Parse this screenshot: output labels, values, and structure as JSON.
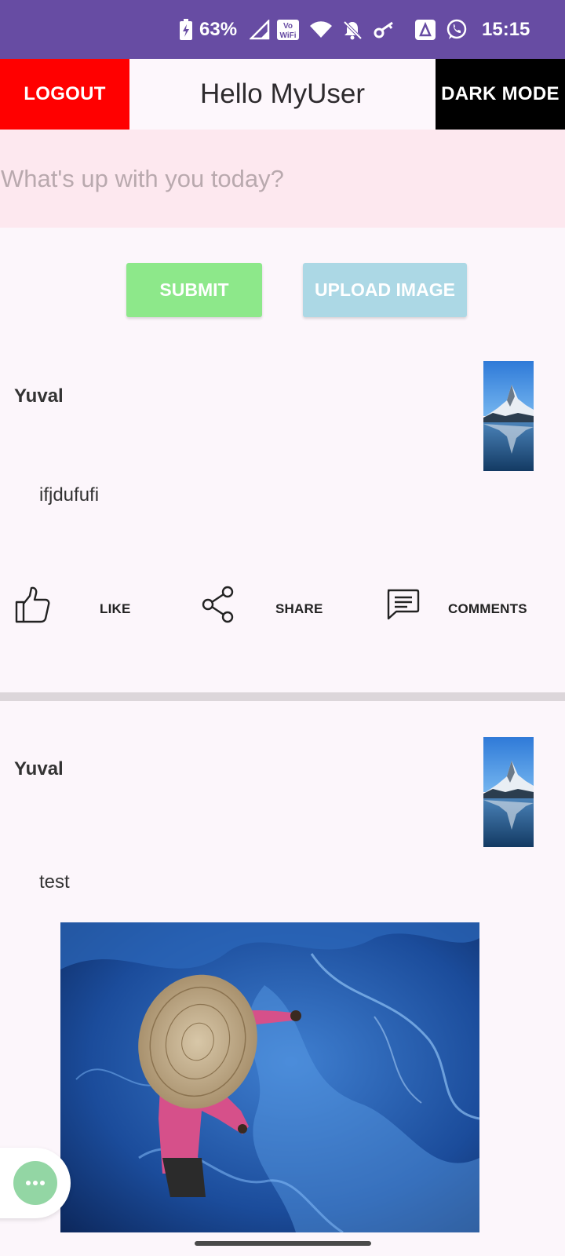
{
  "status_bar": {
    "battery_percent": "63%",
    "time": "15:15",
    "icons": [
      "battery-charging-icon",
      "signal-icon",
      "vowifi-icon",
      "wifi-icon",
      "bell-off-icon",
      "vpn-key-icon",
      "tv-app-icon",
      "whatsapp-icon"
    ]
  },
  "header": {
    "logout_label": "LOGOUT",
    "title": "Hello MyUser",
    "dark_mode_label": "DARK MODE"
  },
  "composer": {
    "placeholder": "What's up with you today?",
    "submit_label": "SUBMIT",
    "upload_label": "UPLOAD IMAGE"
  },
  "posts": [
    {
      "author": "Yuval",
      "body": "ifjdufufi",
      "actions": {
        "like": "LIKE",
        "share": "SHARE",
        "comments": "COMMENTS"
      }
    },
    {
      "author": "Yuval",
      "body": "test"
    }
  ],
  "colors": {
    "status_bar": "#674ca3",
    "logout": "#ff0000",
    "dark_mode": "#000000",
    "submit": "#8de88a",
    "upload": "#acd8e5",
    "fab": "#93d6a4",
    "input_bg": "#fde8ef",
    "page_bg": "#fcf6fb"
  }
}
